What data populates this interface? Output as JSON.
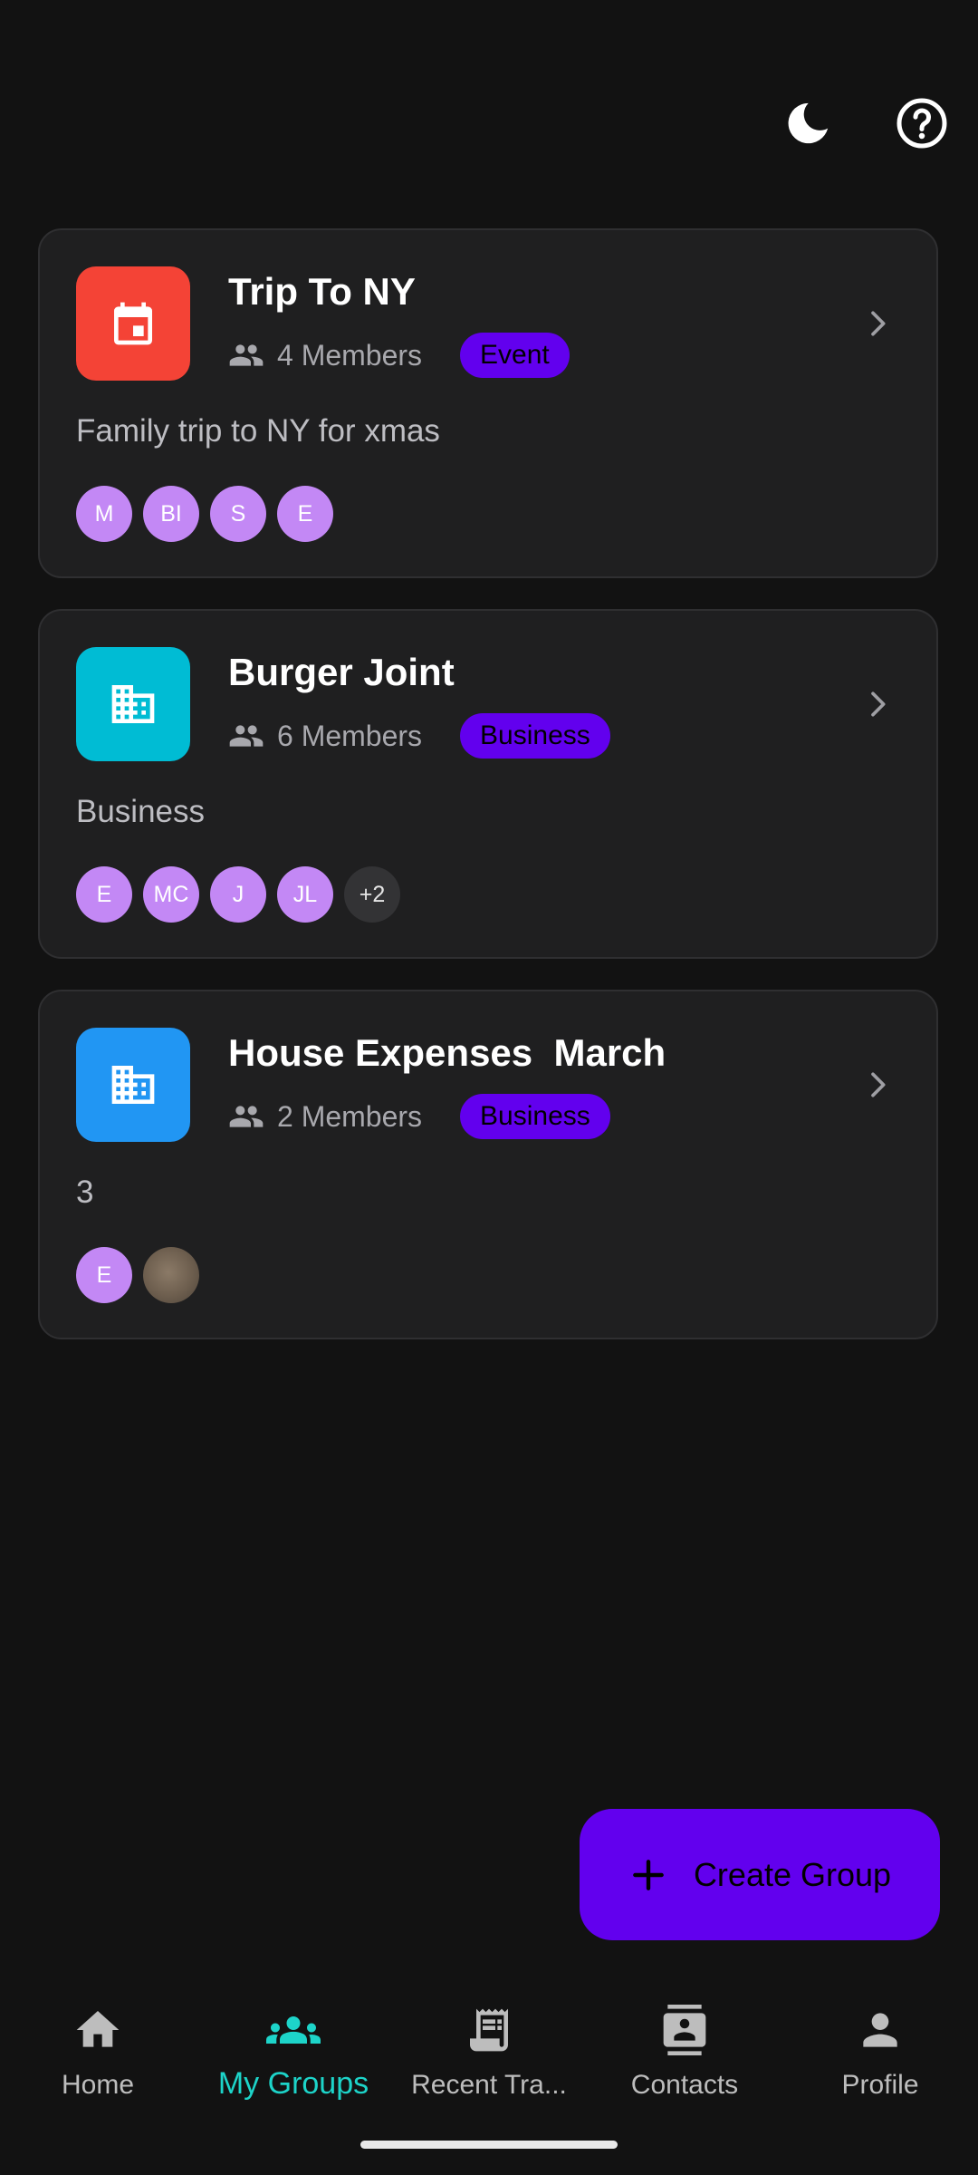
{
  "header": {
    "theme_icon": "moon-icon",
    "help_icon": "help-circle-icon"
  },
  "groups": [
    {
      "title": "Trip To NY",
      "members": "4 Members",
      "badge": "Event",
      "description": "Family trip to NY for xmas",
      "icon": "calendar-icon",
      "icon_color": "#f44336",
      "avatars": [
        "M",
        "BI",
        "S",
        "E"
      ]
    },
    {
      "title": "Burger Joint",
      "members": "6 Members",
      "badge": "Business",
      "description": "Business",
      "icon": "building-icon",
      "icon_color": "#00bcd4",
      "avatars": [
        "E",
        "MC",
        "J",
        "JL"
      ],
      "more": "+2"
    },
    {
      "title": "House Expenses  March",
      "members": "2 Members",
      "badge": "Business",
      "description": "3",
      "icon": "building-icon",
      "icon_color": "#2196f3",
      "avatars": [
        "E"
      ]
    }
  ],
  "fab": {
    "label": "Create Group",
    "icon": "plus-icon"
  },
  "nav": [
    {
      "label": "Home",
      "icon": "home-icon"
    },
    {
      "label": "My Groups",
      "icon": "groups-icon",
      "active": true
    },
    {
      "label": "Recent Tra...",
      "icon": "receipt-icon"
    },
    {
      "label": "Contacts",
      "icon": "contacts-icon"
    },
    {
      "label": "Profile",
      "icon": "person-icon"
    }
  ],
  "colors": {
    "accent": "#6200ee",
    "active_nav": "#1dd4c9",
    "background": "#121212",
    "card": "#1f1f20"
  }
}
